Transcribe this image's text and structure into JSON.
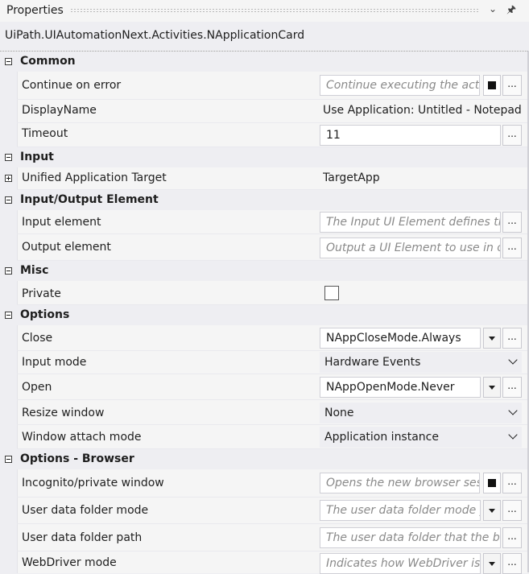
{
  "panel": {
    "title": "Properties",
    "type_name": "UiPath.UIAutomationNext.Activities.NApplicationCard"
  },
  "categories": {
    "common": "Common",
    "input": "Input",
    "input_output_element": "Input/Output Element",
    "misc": "Misc",
    "options": "Options",
    "options_browser": "Options - Browser"
  },
  "props": {
    "continue_on_error": {
      "label": "Continue on error",
      "placeholder": "Continue executing the activ"
    },
    "display_name": {
      "label": "DisplayName",
      "value": "Use Application: Untitled - Notepad"
    },
    "timeout": {
      "label": "Timeout",
      "value": "11"
    },
    "unified_target": {
      "label": "Unified Application Target",
      "value": "TargetApp"
    },
    "input_element": {
      "label": "Input element",
      "placeholder": "The Input UI Element defines the"
    },
    "output_element": {
      "label": "Output element",
      "placeholder": "Output a UI Element to use in ot"
    },
    "private": {
      "label": "Private",
      "checked": false
    },
    "close": {
      "label": "Close",
      "value": "NAppCloseMode.Always"
    },
    "input_mode": {
      "label": "Input mode",
      "value": "Hardware Events"
    },
    "open": {
      "label": "Open",
      "value": "NAppOpenMode.Never"
    },
    "resize_window": {
      "label": "Resize window",
      "value": "None"
    },
    "window_attach_mode": {
      "label": "Window attach mode",
      "value": "Application instance"
    },
    "incognito": {
      "label": "Incognito/private window",
      "placeholder": "Opens the new browser sessi"
    },
    "user_data_folder_mode": {
      "label": "User data folder mode",
      "placeholder": "The user data folder mode yo"
    },
    "user_data_folder_path": {
      "label": "User data folder path",
      "placeholder": "The user data folder that the bro"
    },
    "webdriver_mode": {
      "label": "WebDriver mode",
      "placeholder": "Indicates how WebDriver is u"
    }
  },
  "icons": {
    "ellipsis": "...",
    "pin": "pin-icon",
    "dropdown": "chevron-down-icon"
  }
}
